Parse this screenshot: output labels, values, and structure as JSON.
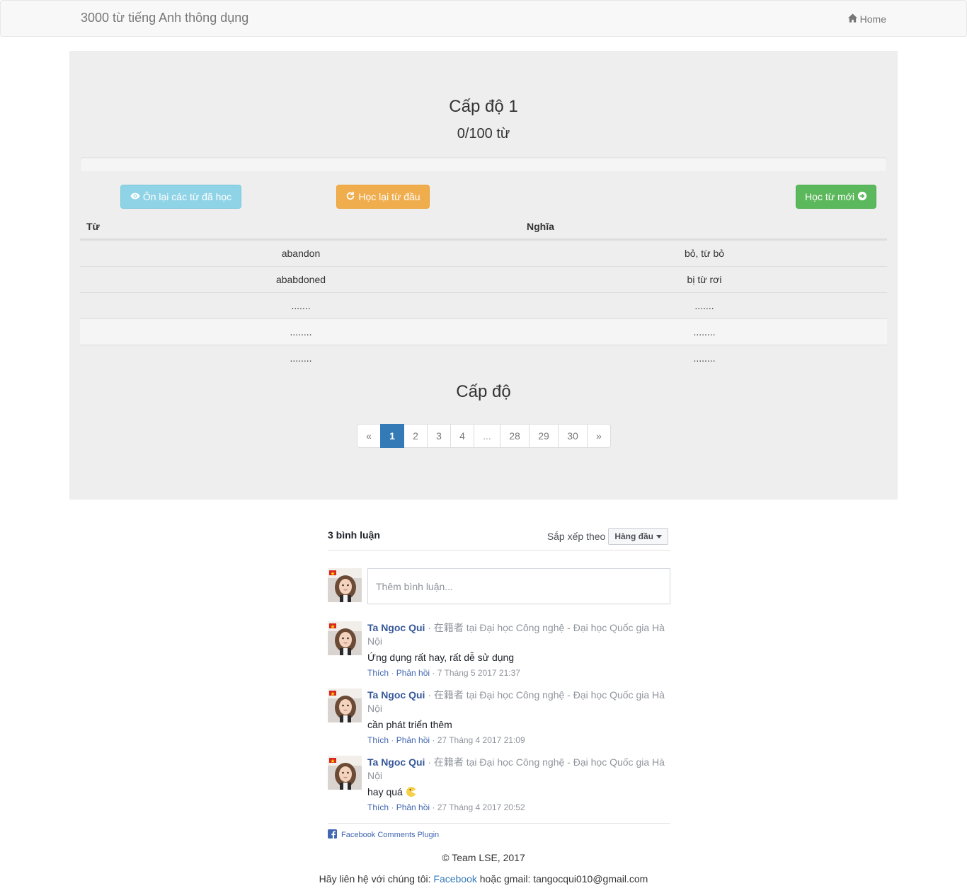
{
  "navbar": {
    "brand": "3000 từ tiếng Anh thông dụng",
    "home_label": "Home"
  },
  "level": {
    "title": "Cấp độ 1",
    "count": "0/100 từ",
    "progress": 0
  },
  "buttons": {
    "review_label": "Ôn lại các từ đã học",
    "restart_label": "Học lại từ đầu",
    "learn_new_label": "Học từ mới"
  },
  "table": {
    "headers": [
      "Từ",
      "Nghĩa"
    ],
    "rows": [
      [
        "abandon",
        "bỏ, từ bỏ"
      ],
      [
        "ababdoned",
        "bị từ rơi"
      ],
      [
        ".......",
        "......."
      ],
      [
        "........",
        "........"
      ],
      [
        "........",
        "........"
      ]
    ]
  },
  "levels_heading": "Cấp độ",
  "pagination": {
    "prev": "«",
    "pages": [
      "1",
      "2",
      "3",
      "4",
      "...",
      "28",
      "29",
      "30"
    ],
    "next": "»",
    "active": "1"
  },
  "comments": {
    "count_label": "3 bình luận",
    "sort_label": "Sắp xếp theo",
    "sort_value": "Hàng đầu",
    "input_placeholder": "Thêm bình luận...",
    "items": [
      {
        "name": "Ta Ngoc Qui",
        "affiliation": " · 在籍者 tại Đại học Công nghệ - Đại học Quốc gia Hà Nội",
        "text": "Ứng dụng rất hay, rất dễ sử dụng",
        "like": "Thích",
        "reply": "Phản hồi",
        "time": " · 7 Tháng 5 2017 21:37"
      },
      {
        "name": "Ta Ngoc Qui",
        "affiliation": " · 在籍者 tại Đại học Công nghệ - Đại học Quốc gia Hà Nội",
        "text": "cần phát triển thêm",
        "like": "Thích",
        "reply": "Phản hồi",
        "time": " · 27 Tháng 4 2017 21:09"
      },
      {
        "name": "Ta Ngoc Qui",
        "affiliation": " · 在籍者 tại Đại học Công nghệ - Đại học Quốc gia Hà Nội",
        "text": "hay quá ",
        "like": "Thích",
        "reply": "Phản hồi",
        "time": " · 27 Tháng 4 2017 20:52"
      }
    ],
    "plugin_label": "Facebook Comments Plugin"
  },
  "footer": {
    "copyright": "© Team LSE, 2017",
    "contact_prefix": "Hãy liên hệ với chúng tôi: ",
    "facebook_link": "Facebook",
    "contact_suffix": " hoặc gmail: tangocqui010@gmail.com"
  },
  "colors": {
    "primary": "#337ab7",
    "info": "#8fd3e6",
    "warning": "#f0ad4e",
    "success": "#5cb85c",
    "jumbotron": "#eeeeee",
    "fb_link": "#365899"
  }
}
